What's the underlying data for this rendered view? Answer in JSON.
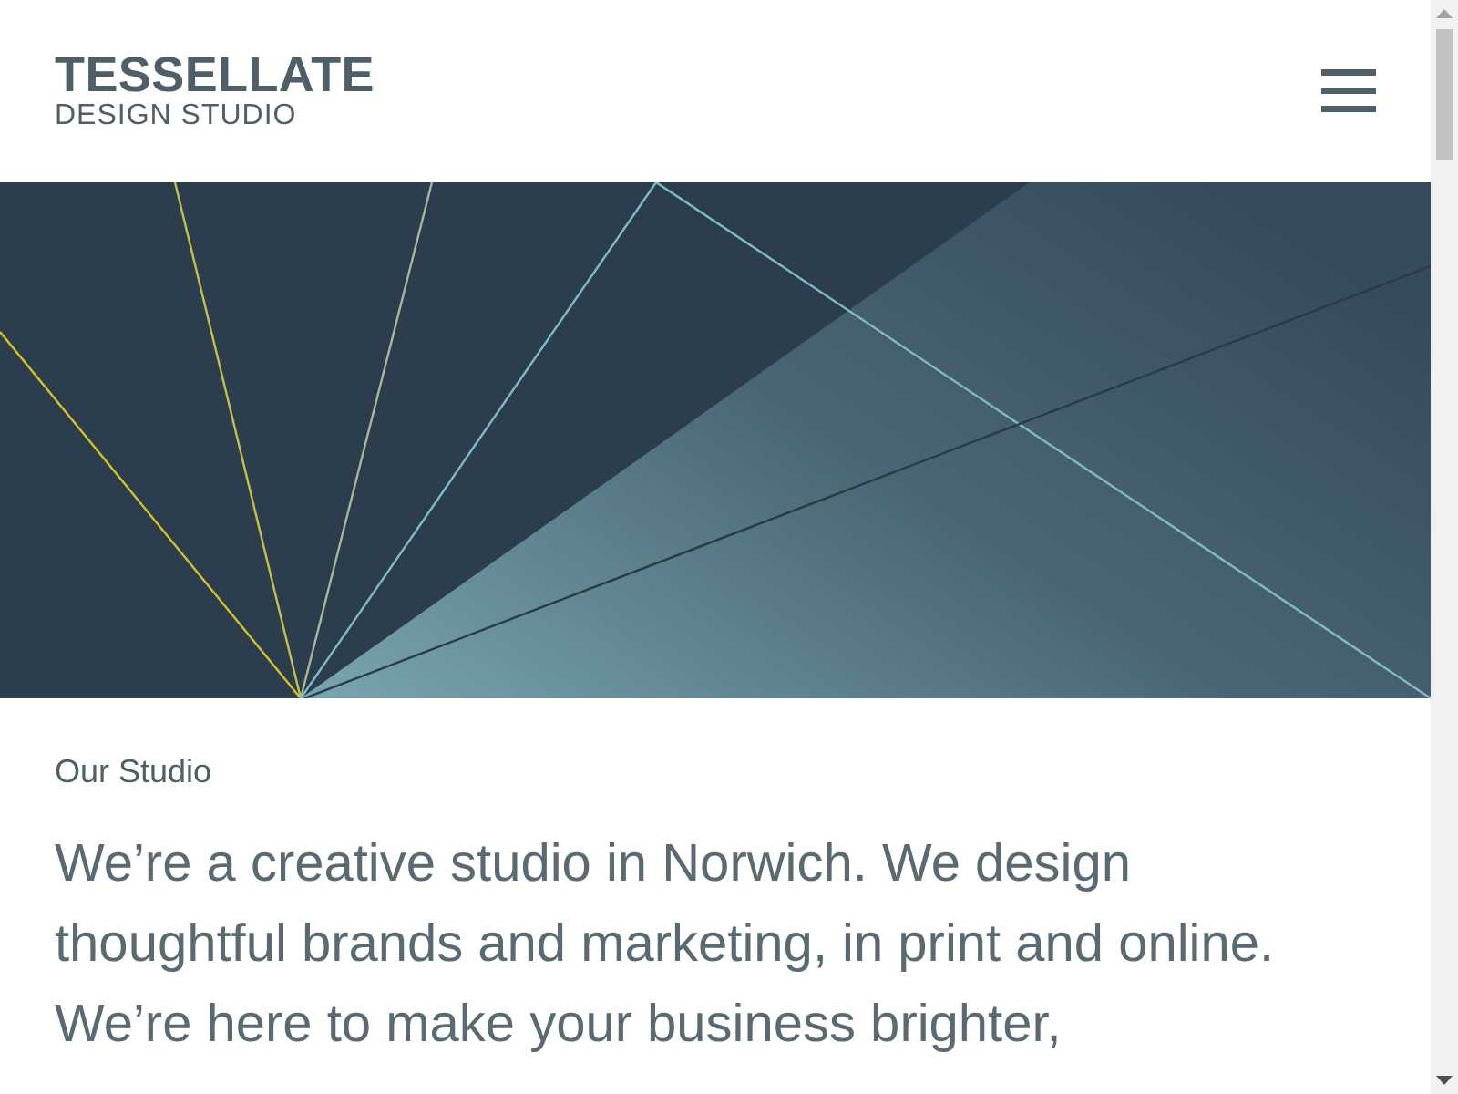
{
  "header": {
    "logo_title": "TESSELLATE",
    "logo_subtitle": "DESIGN STUDIO"
  },
  "section": {
    "heading": "Our Studio",
    "intro": "We’re a creative studio in Norwich. We design thoughtful brands and marketing, in print and online. We’re here to make your business brighter,"
  }
}
